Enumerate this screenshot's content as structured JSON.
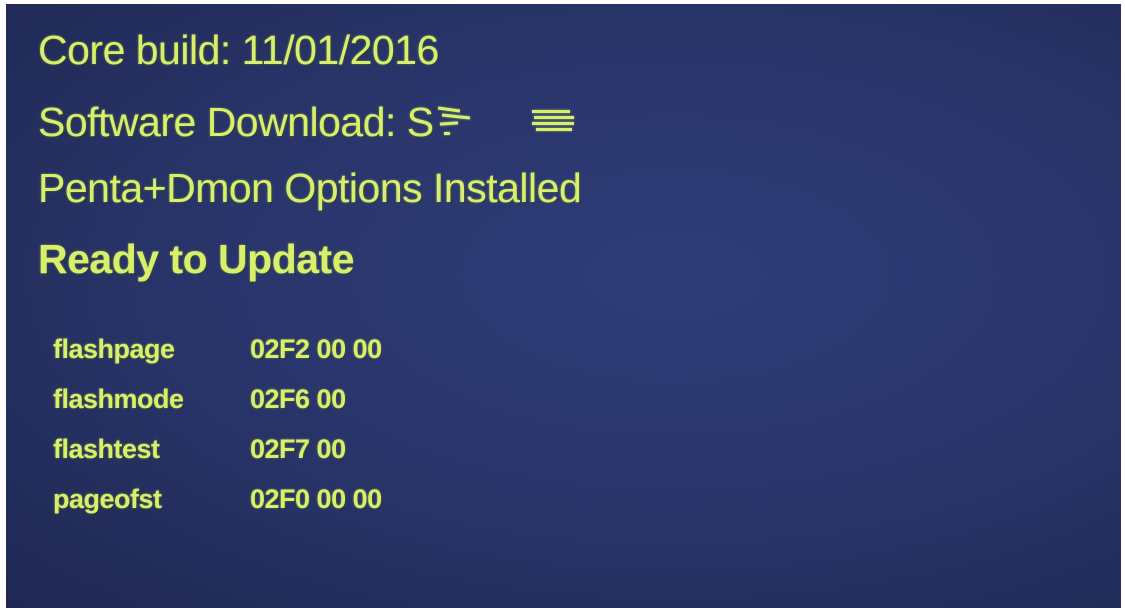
{
  "lines": {
    "core_build": "Core build: 11/01/2016",
    "software_download_prefix": "Software Download: S",
    "options": "Penta+Dmon Options Installed",
    "ready": "Ready to Update"
  },
  "registers": [
    {
      "name": "flashpage",
      "value": "02F2 00 00"
    },
    {
      "name": "flashmode",
      "value": "02F6 00"
    },
    {
      "name": "flashtest",
      "value": "02F7 00"
    },
    {
      "name": "pageofst",
      "value": "02F0 00 00"
    }
  ],
  "colors": {
    "background": "#283468",
    "text": "#d8ef6a"
  }
}
